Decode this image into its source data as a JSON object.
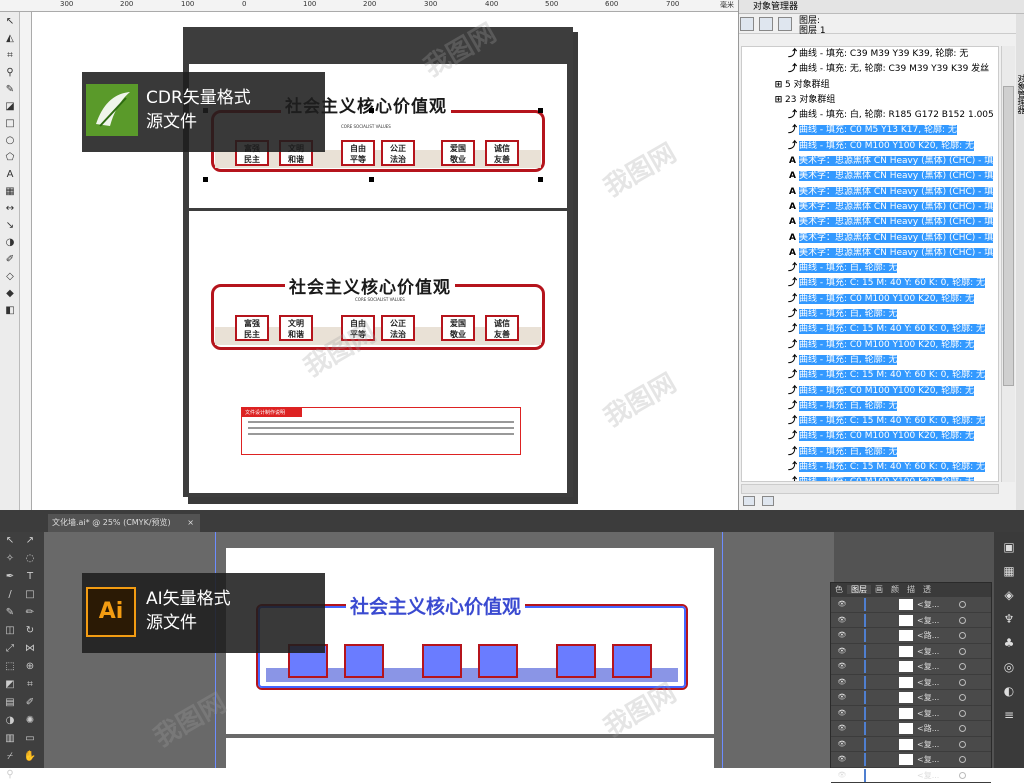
{
  "cdr": {
    "ruler_ticks": [
      "300",
      "200",
      "100",
      "0",
      "100",
      "200",
      "300",
      "400",
      "500",
      "600",
      "700",
      "毫米"
    ],
    "tools": [
      "pick-tool",
      "shape-tool",
      "crop-tool",
      "zoom-tool",
      "freehand-tool",
      "smart-fill-tool",
      "rectangle-tool",
      "ellipse-tool",
      "polygon-tool",
      "text-tool",
      "table-tool",
      "dimension-tool",
      "connector-tool",
      "blend-tool",
      "eyedropper-tool",
      "outline-tool",
      "fill-tool",
      "interactive-fill-tool"
    ],
    "banner": {
      "line1": "CDR矢量格式",
      "line2": "源文件"
    },
    "design": {
      "title": "社会主义核心价值观",
      "subtitle": "CORE SOCIALIST VALUES",
      "boxes_top": [
        "富强\n民主",
        "文明\n和谐",
        "自由\n平等",
        "公正\n法治",
        "爱国\n敬业",
        "诚信\n友善"
      ],
      "boxes_bottom": [
        "富强\n民主",
        "文明\n和谐",
        "自由\n平等",
        "公正\n法治",
        "爱国\n敬业",
        "诚信\n友善"
      ],
      "info_title": "文件设计制作说明"
    }
  },
  "object_manager": {
    "title": "对象管理器",
    "layer_header": {
      "line1": "图层:",
      "line2": "图层 1"
    },
    "side_tabs": "对象管理器",
    "rows": [
      {
        "icon": "curve",
        "text": "曲线 - 填充: C39 M39 Y39 K39, 轮廓: 无",
        "hl": false
      },
      {
        "icon": "curve",
        "text": "曲线 - 填充: 无, 轮廓: C39 M39 Y39 K39 发丝",
        "hl": false
      },
      {
        "icon": "group",
        "text": "5 对象群组",
        "hl": false
      },
      {
        "icon": "group",
        "text": "23 对象群组",
        "hl": false
      },
      {
        "icon": "curve",
        "text": "曲线 - 填充: 白, 轮廓: R185 G172 B152  1.005",
        "hl": false
      },
      {
        "icon": "curve",
        "text": "曲线 - 填充: C0 M5 Y13 K17, 轮廓: 无",
        "hl": true
      },
      {
        "icon": "curve",
        "text": "曲线 - 填充: C0 M100 Y100 K20, 轮廓: 无",
        "hl": true
      },
      {
        "icon": "text",
        "text": "美术字：思源黑体 CN Heavy (黑体) (CHC) - 填",
        "hl": true
      },
      {
        "icon": "text",
        "text": "美术字：思源黑体 CN Heavy (黑体) (CHC) - 填",
        "hl": true
      },
      {
        "icon": "text",
        "text": "美术字：思源黑体 CN Heavy (黑体) (CHC) - 填",
        "hl": true
      },
      {
        "icon": "text",
        "text": "美术字：思源黑体 CN Heavy (黑体) (CHC) - 填",
        "hl": true
      },
      {
        "icon": "text",
        "text": "美术字：思源黑体 CN Heavy (黑体) (CHC) - 填",
        "hl": true
      },
      {
        "icon": "text",
        "text": "美术字：思源黑体 CN Heavy (黑体) (CHC) - 填",
        "hl": true
      },
      {
        "icon": "text",
        "text": "美术字：思源黑体 CN Heavy (黑体) (CHC) - 填",
        "hl": true
      },
      {
        "icon": "curve",
        "text": "曲线 - 填充: 白, 轮廓: 无",
        "hl": true
      },
      {
        "icon": "curve",
        "text": "曲线 - 填充: C: 15 M: 40 Y: 60 K: 0, 轮廓: 无",
        "hl": true
      },
      {
        "icon": "curve",
        "text": "曲线 - 填充: C0 M100 Y100 K20, 轮廓: 无",
        "hl": true
      },
      {
        "icon": "curve",
        "text": "曲线 - 填充: 白, 轮廓: 无",
        "hl": true
      },
      {
        "icon": "curve",
        "text": "曲线 - 填充: C: 15 M: 40 Y: 60 K: 0, 轮廓: 无",
        "hl": true
      },
      {
        "icon": "curve",
        "text": "曲线 - 填充: C0 M100 Y100 K20, 轮廓: 无",
        "hl": true
      },
      {
        "icon": "curve",
        "text": "曲线 - 填充: 白, 轮廓: 无",
        "hl": true
      },
      {
        "icon": "curve",
        "text": "曲线 - 填充: C: 15 M: 40 Y: 60 K: 0, 轮廓: 无",
        "hl": true
      },
      {
        "icon": "curve",
        "text": "曲线 - 填充: C0 M100 Y100 K20, 轮廓: 无",
        "hl": true
      },
      {
        "icon": "curve",
        "text": "曲线 - 填充: 白, 轮廓: 无",
        "hl": true
      },
      {
        "icon": "curve",
        "text": "曲线 - 填充: C: 15 M: 40 Y: 60 K: 0, 轮廓: 无",
        "hl": true
      },
      {
        "icon": "curve",
        "text": "曲线 - 填充: C0 M100 Y100 K20, 轮廓: 无",
        "hl": true
      },
      {
        "icon": "curve",
        "text": "曲线 - 填充: 白, 轮廓: 无",
        "hl": true
      },
      {
        "icon": "curve",
        "text": "曲线 - 填充: C: 15 M: 40 Y: 60 K: 0, 轮廓: 无",
        "hl": true
      },
      {
        "icon": "curve",
        "text": "曲线 - 填充: C0 M100 Y100 K20, 轮廓: 无",
        "hl": true
      }
    ]
  },
  "ai": {
    "doc_tab": "文化墙.ai* @ 25% (CMYK/预览)",
    "close_glyph": "×",
    "banner": {
      "line1": "AI矢量格式",
      "line2": "源文件"
    },
    "design_title": "社会主义核心价值观",
    "layers_tabs": [
      "色",
      "图层",
      "画",
      "颜",
      "描",
      "透"
    ],
    "layer_rows": [
      "<复...",
      "<复...",
      "<路...",
      "<复...",
      "<复...",
      "<复...",
      "<复...",
      "<复...",
      "<路...",
      "<复...",
      "<复...",
      "<复..."
    ]
  },
  "watermark": "我图网",
  "colors": {
    "red": "#b5141c",
    "highlight": "#3399ff",
    "ai_bg": "#535353"
  }
}
